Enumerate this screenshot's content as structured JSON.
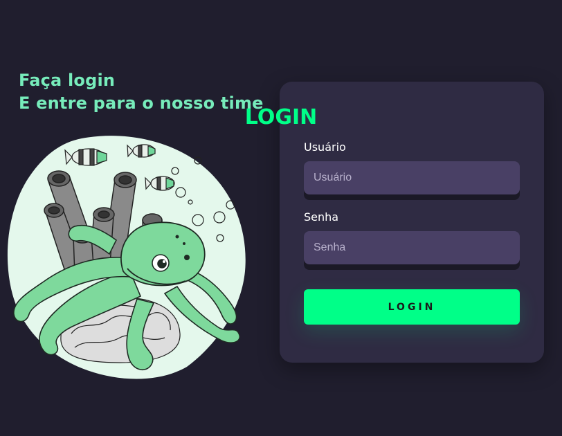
{
  "hero": {
    "line1": "Faça login",
    "line2": "E entre para o nosso time"
  },
  "illustration": {
    "name": "octopus-coral-reef-illustration"
  },
  "login": {
    "title": "LOGIN",
    "username": {
      "label": "Usuário",
      "placeholder": "Usuário",
      "value": ""
    },
    "password": {
      "label": "Senha",
      "placeholder": "Senha",
      "value": ""
    },
    "submit_label": "LOGIN"
  },
  "colors": {
    "background": "#201e2e",
    "card": "#2f2b43",
    "input": "#494065",
    "accent": "#00ff88",
    "hero_text": "#77ecbb"
  }
}
